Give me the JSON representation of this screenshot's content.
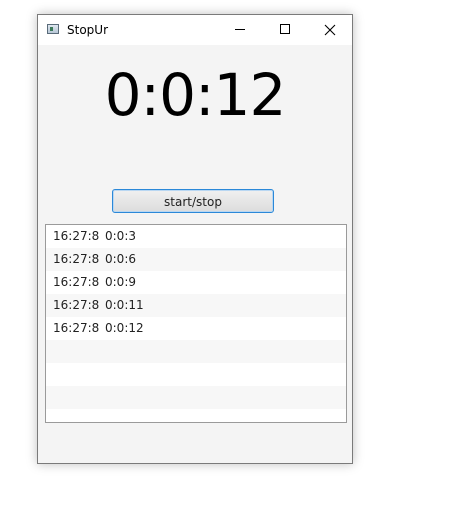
{
  "window": {
    "title": "StopUr"
  },
  "timer": {
    "display": "0:0:12"
  },
  "controls": {
    "start_stop_label": "start/stop"
  },
  "laps": [
    {
      "time": "16:27:8",
      "elapsed": "0:0:3"
    },
    {
      "time": "16:27:8",
      "elapsed": "0:0:6"
    },
    {
      "time": "16:27:8",
      "elapsed": "0:0:9"
    },
    {
      "time": "16:27:8",
      "elapsed": "0:0:11"
    },
    {
      "time": "16:27:8",
      "elapsed": "0:0:12"
    },
    {
      "time": "",
      "elapsed": ""
    },
    {
      "time": "",
      "elapsed": ""
    },
    {
      "time": "",
      "elapsed": ""
    }
  ]
}
